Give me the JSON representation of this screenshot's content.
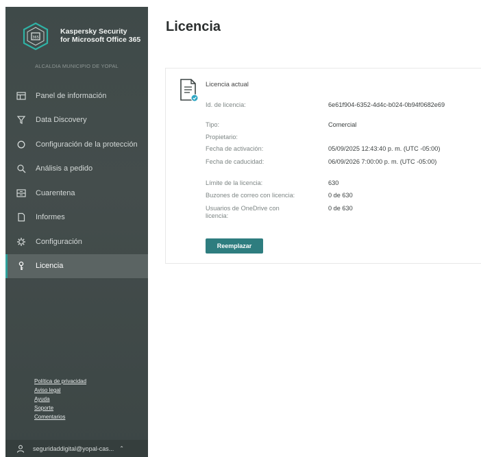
{
  "sidebar": {
    "brand_line1": "Kaspersky Security",
    "brand_line2": "for Microsoft Office 365",
    "org": "ALCALDIA MUNICIPIO DE YOPAL",
    "items": [
      {
        "label": "Panel de información",
        "icon": "dashboard-icon"
      },
      {
        "label": "Data Discovery",
        "icon": "filter-icon"
      },
      {
        "label": "Configuración de la protección",
        "icon": "shield-circle-icon"
      },
      {
        "label": "Análisis a pedido",
        "icon": "search-icon"
      },
      {
        "label": "Cuarentena",
        "icon": "quarantine-icon"
      },
      {
        "label": "Informes",
        "icon": "report-icon"
      },
      {
        "label": "Configuración",
        "icon": "gear-icon"
      },
      {
        "label": "Licencia",
        "icon": "key-icon"
      }
    ],
    "active_item": "Licencia",
    "footer_links": [
      "Política de privacidad",
      "Aviso legal",
      "Ayuda",
      "Soporte",
      "Comentarios"
    ],
    "user": "seguridaddigital@yopal-cas..."
  },
  "main": {
    "title": "Licencia",
    "card": {
      "title": "Licencia actual",
      "rows": [
        {
          "label": "Id. de licencia:",
          "value": "6e61f904-6352-4d4c-b024-0b94f0682e69"
        },
        {
          "label": "Tipo:",
          "value": "Comercial"
        },
        {
          "label": "Propietario:",
          "value": ""
        },
        {
          "label": "Fecha de activación:",
          "value": "05/09/2025 12:43:40 p. m. (UTC -05:00)"
        },
        {
          "label": "Fecha de caducidad:",
          "value": "06/09/2026 7:00:00 p. m. (UTC -05:00)"
        },
        {
          "label": "Límite de la licencia:",
          "value": "630"
        },
        {
          "label": "Buzones de correo con licencia:",
          "value": "0 de 630"
        },
        {
          "label": "Usuarios de OneDrive con licencia:",
          "value": "0 de 630"
        }
      ],
      "button_label": "Reemplazar"
    }
  },
  "colors": {
    "sidebar_bg": "#434c4b",
    "active_bg": "#5b6463",
    "accent": "#2e7d7f"
  }
}
